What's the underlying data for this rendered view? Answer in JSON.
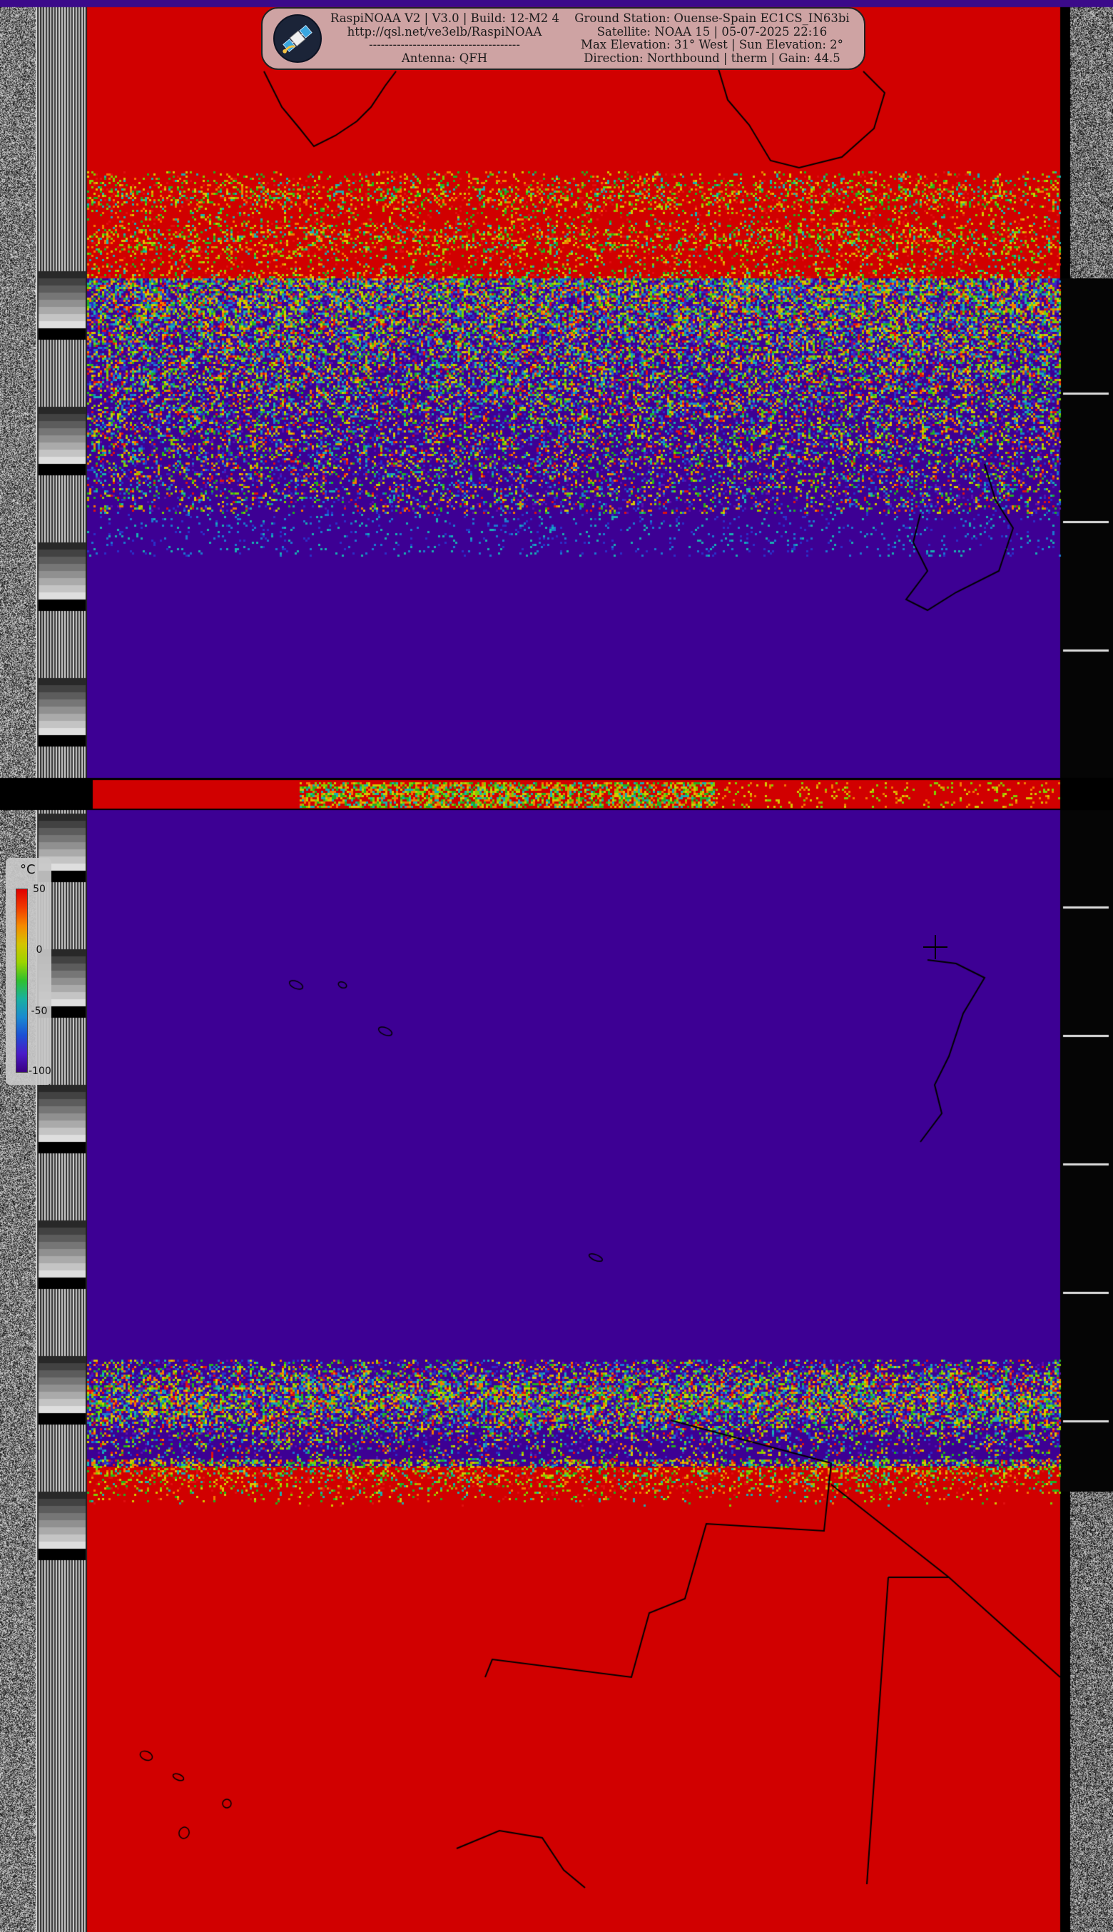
{
  "header": {
    "left": {
      "line1": "RaspiNOAA V2 | V3.0 | Build: 12-M2 4",
      "line2": "http://qsl.net/ve3elb/RaspiNOAA",
      "line3": "--------------------------------------",
      "line4": "Antenna: QFH"
    },
    "right": {
      "line1": "Ground Station: Ouense-Spain EC1CS_IN63bi",
      "line2": "Satellite: NOAA 15 | 05-07-2025 22:16",
      "line3": "Max Elevation: 31° West | Sun Elevation: 2°",
      "line4": "Direction: Northbound | therm | Gain: 44.5"
    }
  },
  "legend": {
    "unit": "°C",
    "ticks": [
      "50",
      "0",
      "-50",
      "-100"
    ]
  },
  "icons": {
    "logo": "satellite-logo-icon",
    "marker": "crosshair-icon"
  },
  "colors": {
    "warm": "#d10000",
    "cold": "#3d0094",
    "telemetry_gray": "#808080"
  }
}
